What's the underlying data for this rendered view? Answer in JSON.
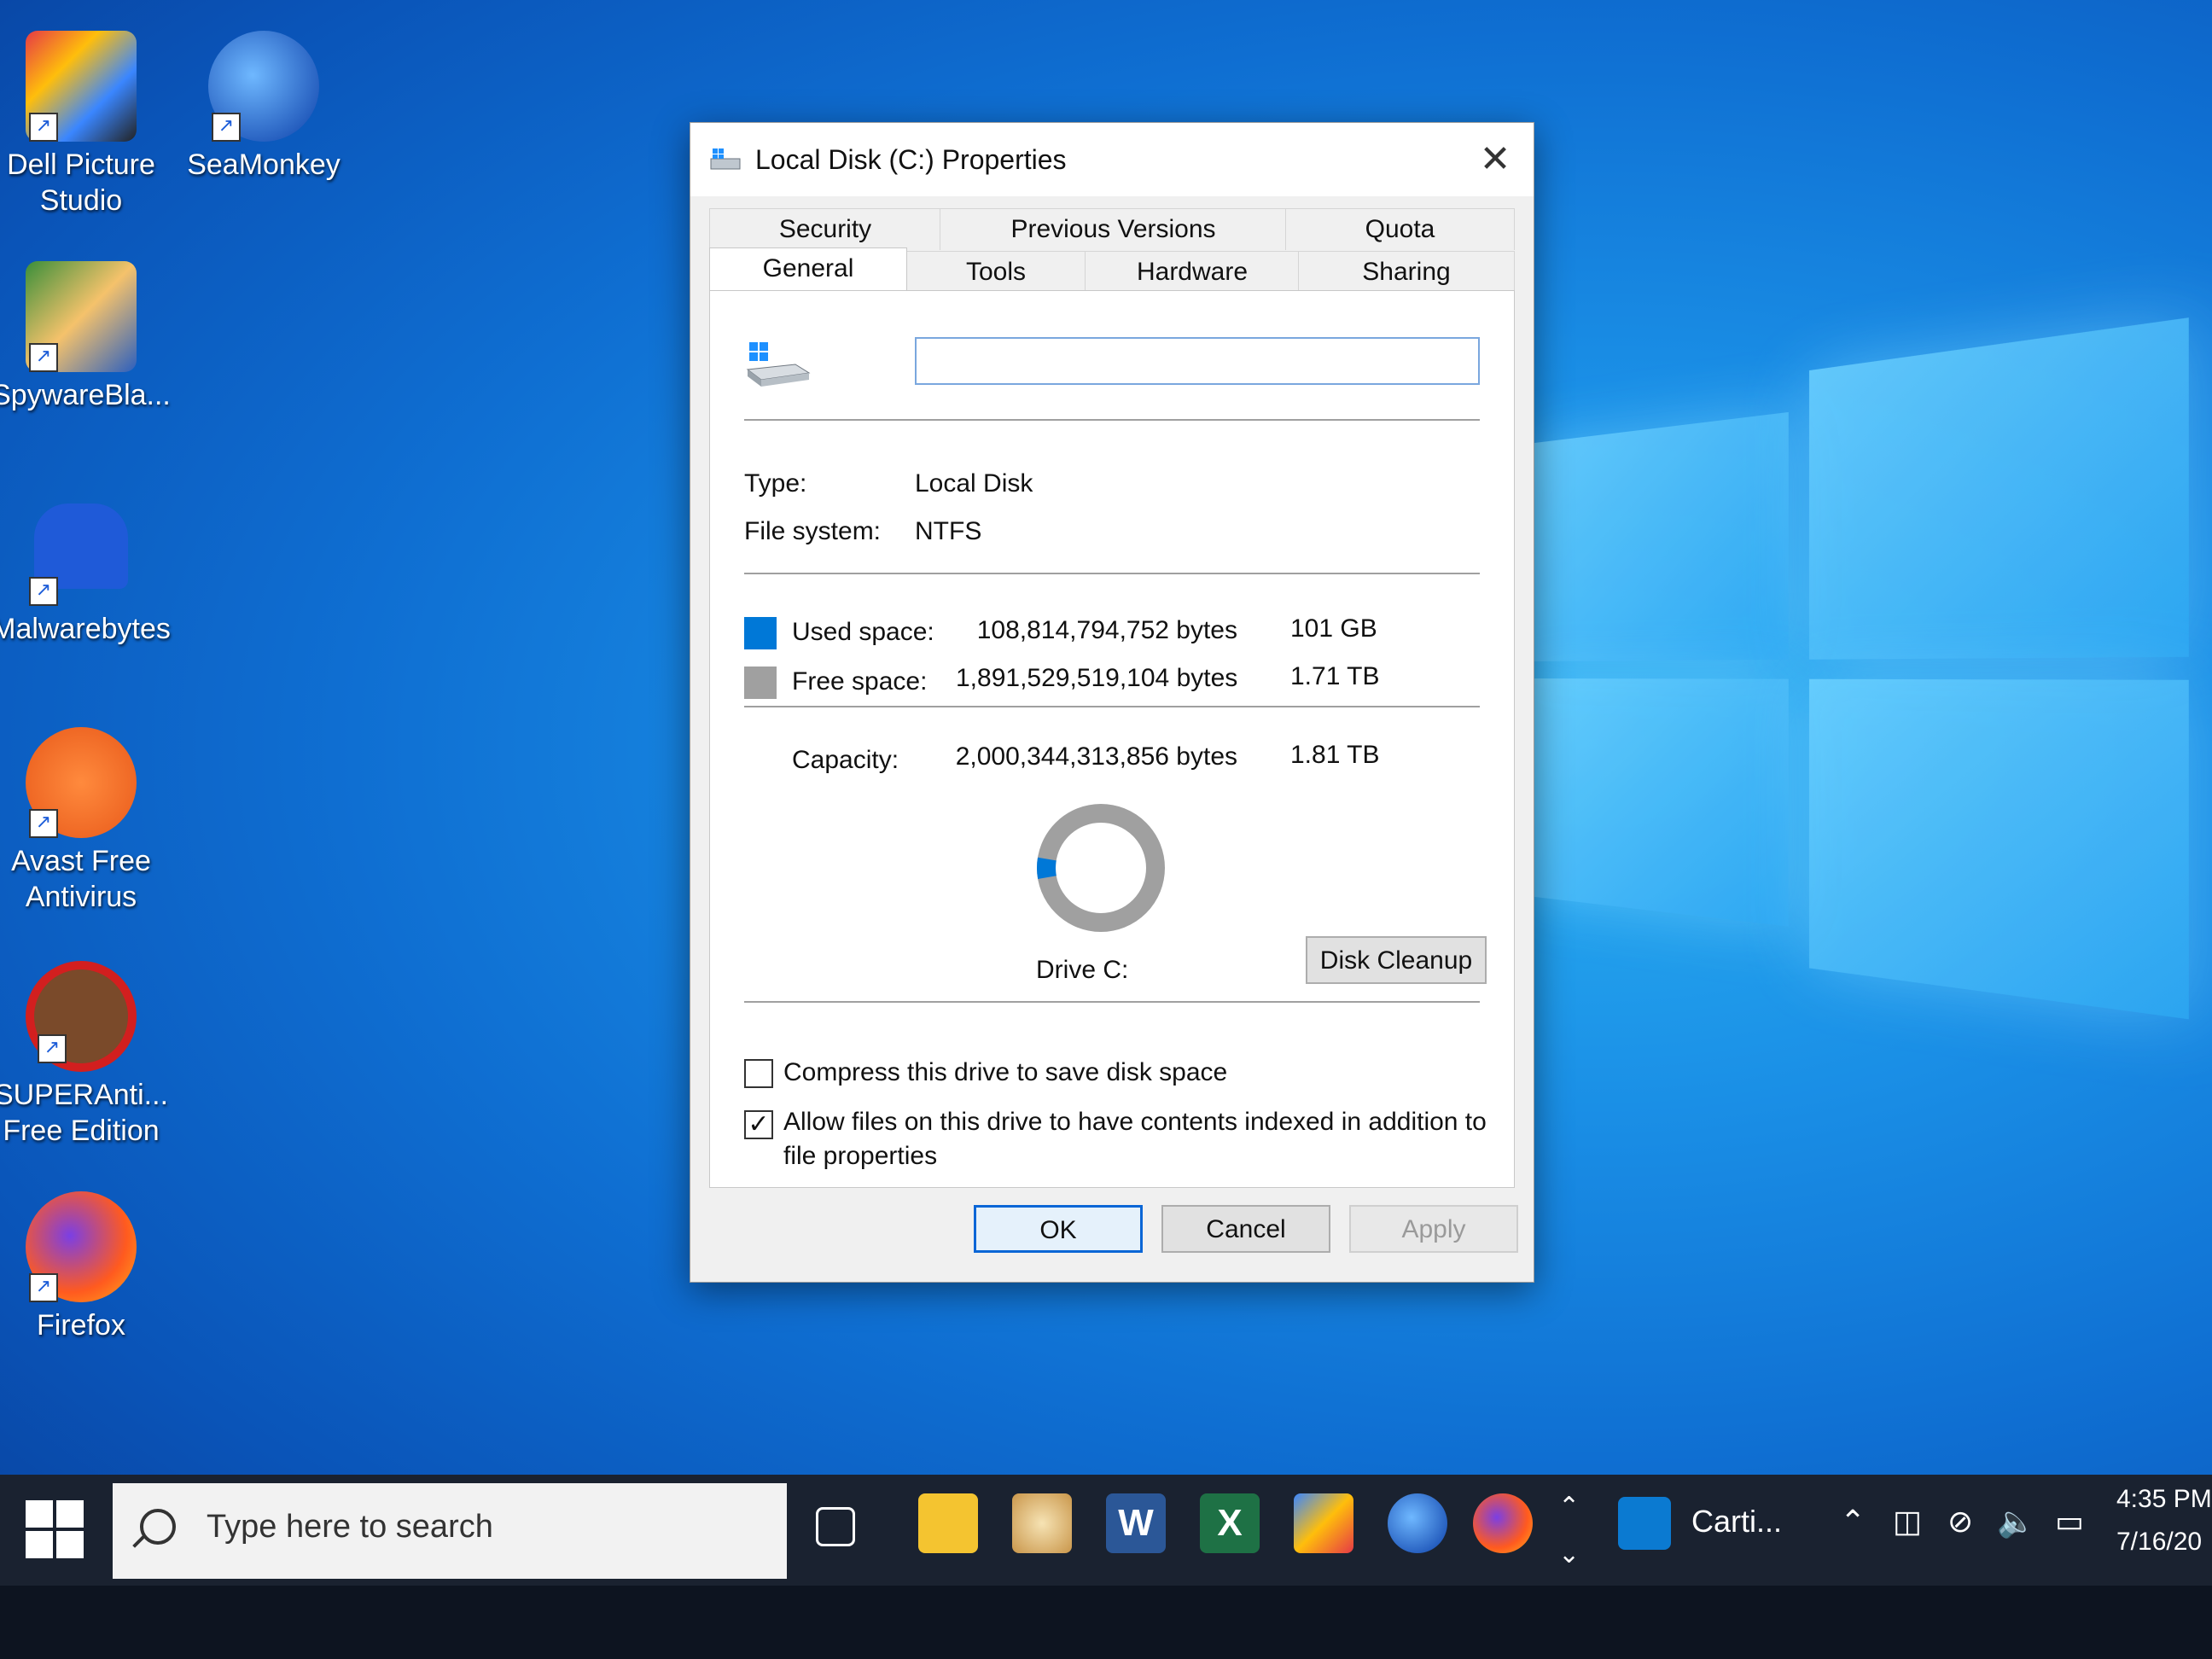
{
  "desktop": {
    "icons": [
      {
        "label": "Dell Picture Studio",
        "icon": "dell-picture-studio-icon"
      },
      {
        "label": "SeaMonkey",
        "icon": "seamonkey-icon"
      },
      {
        "label": "SpywareBla...",
        "icon": "spywareblaster-icon"
      },
      {
        "label": "Malwarebytes",
        "icon": "malwarebytes-icon"
      },
      {
        "label": "Avast Free Antivirus",
        "icon": "avast-icon"
      },
      {
        "label": "SUPERAnti... Free Edition",
        "icon": "superantispyware-icon"
      },
      {
        "label": "Firefox",
        "icon": "firefox-icon"
      }
    ]
  },
  "dialog": {
    "title": "Local Disk (C:) Properties",
    "close": "✕",
    "tabs_back": [
      "Security",
      "Previous Versions",
      "Quota"
    ],
    "tabs_front": [
      "General",
      "Tools",
      "Hardware",
      "Sharing"
    ],
    "active_tab": "General",
    "volume_name_value": "",
    "type_label": "Type:",
    "type_value": "Local Disk",
    "fs_label": "File system:",
    "fs_value": "NTFS",
    "used_label": "Used space:",
    "used_bytes": "108,814,794,752 bytes",
    "used_size": "101 GB",
    "free_label": "Free space:",
    "free_bytes": "1,891,529,519,104 bytes",
    "free_size": "1.71 TB",
    "capacity_label": "Capacity:",
    "capacity_bytes": "2,000,344,313,856 bytes",
    "capacity_size": "1.81 TB",
    "used_fraction": 0.054,
    "used_color": "#0078d7",
    "free_color": "#a0a0a0",
    "drive_label": "Drive C:",
    "disk_cleanup": "Disk Cleanup",
    "compress_label": "Compress this drive to save disk space",
    "compress_checked": false,
    "index_label_line1": "Allow files on this drive to have contents indexed in addition to",
    "index_label_line2": "file properties",
    "index_checked": true,
    "ok": "OK",
    "cancel": "Cancel",
    "apply": "Apply"
  },
  "taskbar": {
    "search_placeholder": "Type here to search",
    "pinned": [
      "task-view-icon",
      "file-explorer-icon",
      "paint-icon",
      "word-icon",
      "excel-icon",
      "network-app-icon",
      "seamonkey-icon",
      "firefox-icon"
    ],
    "running_app_label": "Carti...",
    "clock_time": "4:35 PM",
    "clock_date": "7/16/20"
  }
}
